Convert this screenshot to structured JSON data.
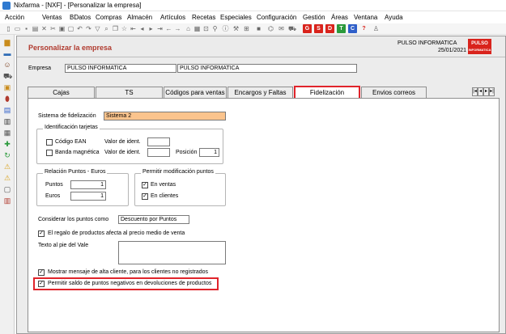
{
  "window": {
    "title": "Nixfarma - [NXF] - [Personalizar la empresa]"
  },
  "menu": [
    "Acción",
    "Ventas",
    "BDatos",
    "Compras",
    "Almacén",
    "Artículos",
    "Recetas",
    "Especiales",
    "Configuración",
    "Gestión",
    "Áreas",
    "Ventana",
    "Ayuda"
  ],
  "toolbar_letters": [
    "G",
    "S",
    "D",
    "T",
    "C",
    "?"
  ],
  "toolbar_letter_colors": [
    "#d9231c",
    "#d9231c",
    "#d9231c",
    "#2b9a3c",
    "#2f5fc9",
    "#d9231c"
  ],
  "header": {
    "title": "Personalizar la empresa",
    "company": "PULSO INFORMATICA",
    "date": "25/01/2021",
    "logo_top": "PULSO",
    "logo_bottom": "INFORMATICA"
  },
  "empresa": {
    "label": "Empresa",
    "value1": "PULSO INFORMATICA",
    "value2": "PULSO INFORMATICA"
  },
  "tabs": [
    "Cajas",
    "TS",
    "Códigos para ventas",
    "Encargos y Faltas",
    "Fidelización",
    "Envios correos"
  ],
  "active_tab": "Fidelización",
  "fidelizacion": {
    "sistema_label": "Sistema de fidelización",
    "sistema_value": "Sistema 2",
    "ident": {
      "title": "Identificación tarjetas",
      "ean_label": "Código EAN",
      "banda_label": "Banda magnética",
      "valor_label_1": "Valor de ident.",
      "valor_label_2": "Valor de ident.",
      "posicion_label": "Posición",
      "posicion_value": "1"
    },
    "relacion": {
      "title": "Relación Puntos - Euros",
      "puntos_label": "Puntos",
      "puntos_value": "1",
      "euros_label": "Euros",
      "euros_value": "1"
    },
    "permitir": {
      "title": "Permitir modificación puntos",
      "ventas_label": "En ventas",
      "clientes_label": "En clientes"
    },
    "considerar_label": "Considerar los puntos como",
    "considerar_value": "Descuento por Puntos",
    "regalo_label": "El regalo de productos afecta al precio medio de venta",
    "texto_label": "Texto al pie del Vale",
    "mensaje_label": "Mostrar mensaje de alta cliente, para los clientes no registrados",
    "negativos_label": "Permitir saldo de puntos negativos en devoluciones de productos",
    "check_mark": "✓"
  },
  "colors": {
    "accent_red": "#e0242b",
    "title_red": "#b03a2e",
    "field_orange": "#fbc48d"
  }
}
